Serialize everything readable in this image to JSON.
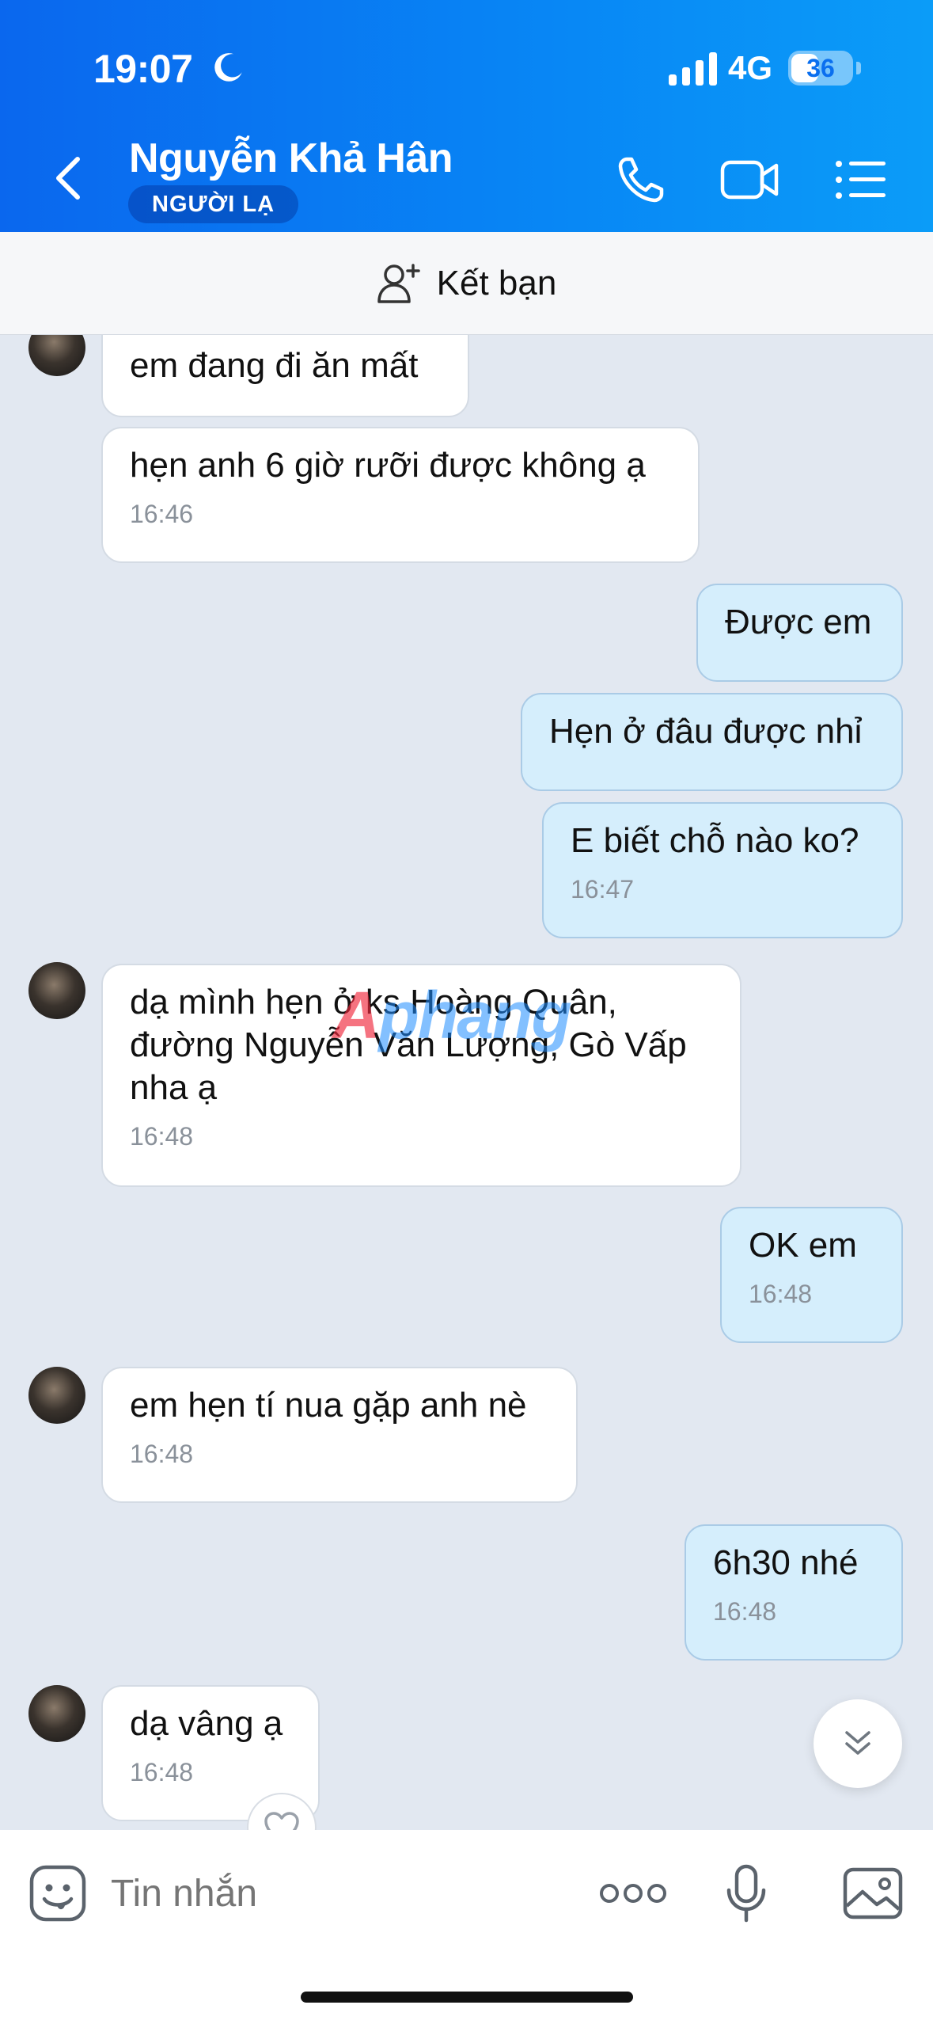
{
  "status_bar": {
    "time": "19:07",
    "network": "4G",
    "battery": "36"
  },
  "header": {
    "contact_name": "Nguyễn Khả Hân",
    "badge": "NGƯỜI LẠ",
    "icons": [
      "back-icon",
      "phone-icon",
      "video-call-icon",
      "menu-list-icon"
    ]
  },
  "friend_bar": {
    "label": "Kết bạn",
    "icon": "add-friend-icon"
  },
  "messages": [
    {
      "dir": "in",
      "text": "em đang đi ăn mất",
      "time": ""
    },
    {
      "dir": "in",
      "text": "hẹn anh 6 giờ rưỡi được không ạ",
      "time": "16:46"
    },
    {
      "dir": "out",
      "text": "Được em",
      "time": ""
    },
    {
      "dir": "out",
      "text": "Hẹn ở đâu được nhỉ",
      "time": ""
    },
    {
      "dir": "out",
      "text": "E biết chỗ nào ko?",
      "time": "16:47"
    },
    {
      "dir": "in",
      "text": "dạ mình hẹn ở ks Hoàng Quân, đường Nguyễn Văn Lượng, Gò Vấp nha ạ",
      "time": "16:48"
    },
    {
      "dir": "out",
      "text": "OK em",
      "time": "16:48"
    },
    {
      "dir": "in",
      "text": "em hẹn tí nua gặp anh nè",
      "time": "16:48"
    },
    {
      "dir": "out",
      "text": "6h30 nhé",
      "time": "16:48"
    },
    {
      "dir": "in",
      "text": "dạ vâng ạ",
      "time": "16:48"
    }
  ],
  "watermark": {
    "first": "A",
    "rest": "phang"
  },
  "input_bar": {
    "placeholder": "Tin nhắn",
    "icons": [
      "emoji-icon",
      "more-icon",
      "microphone-icon",
      "image-icon"
    ]
  },
  "colors": {
    "header_accent": "#0a67ee",
    "outgoing_bubble": "#d5eefc",
    "incoming_bubble": "#ffffff",
    "chat_bg": "#e2e8f1"
  }
}
